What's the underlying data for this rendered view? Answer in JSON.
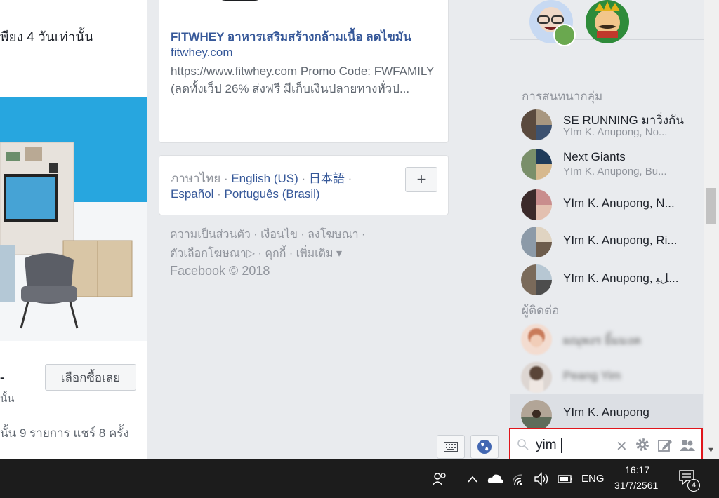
{
  "feed": {
    "left_top_text": "พียง 4 วันเท่านั้น",
    "left_dash": "-",
    "left_fragment": "นั้น",
    "buy_button": "เลือกซื้อเลย",
    "stats": "นั้น 9 รายการ  แชร์ 8 ครั้ง"
  },
  "link_card": {
    "title": "FITWHEY อาหารเสริมสร้างกล้ามเนื้อ ลดไขมัน",
    "domain": "fitwhey.com",
    "description": "https://www.fitwhey.com Promo Code: FWFAMILY (ลดทั้งเว็ป 26% ส่งฟรี มีเก็บเงินปลายทางทั่วป..."
  },
  "languages": {
    "current": "ภาษาไทย",
    "sep": " · ",
    "items": [
      "English (US)",
      "日本語",
      "Español",
      "Português (Brasil)"
    ],
    "plus": "+"
  },
  "footer": {
    "line1": "ความเป็นส่วนตัว · เงื่อนไข · ลงโฆษณา ·",
    "line2": "ตัวเลือกโฆษณา▷ · คุกกี้ · เพิ่มเติม ▾",
    "copyright": "Facebook © 2018"
  },
  "chat": {
    "groups_heading": "การสนทนากลุ่ม",
    "contacts_heading": "ผู้ติดต่อ",
    "groups": [
      {
        "name": "SE RUNNING มาวิ่งกัน",
        "sub": "YIm K. Anupong, No..."
      },
      {
        "name": "Next Giants",
        "sub": "YIm K. Anupong, Bu..."
      },
      {
        "name": "YIm K. Anupong, N...",
        "sub": ""
      },
      {
        "name": "YIm K. Anupong, Ri...",
        "sub": ""
      },
      {
        "name": "YIm K. Anupong, ﻞﻴ...",
        "sub": ""
      }
    ],
    "contacts": [
      {
        "name": "ผณุพงร ยิ้มมงค"
      },
      {
        "name": "Peang Yim"
      },
      {
        "name": "YIm K. Anupong"
      }
    ],
    "search_value": "yim"
  },
  "taskbar": {
    "language": "ENG",
    "time": "16:17",
    "date": "31/7/2561",
    "notifications": "4"
  },
  "colors": {
    "link_blue": "#365899",
    "search_border": "#e0151b",
    "taskbar_bg": "#1c1c1c"
  }
}
